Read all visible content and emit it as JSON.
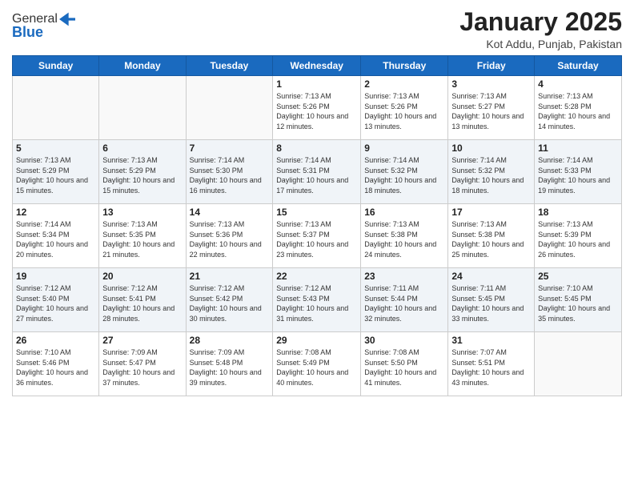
{
  "header": {
    "logo_line1": "General",
    "logo_line2": "Blue",
    "month_title": "January 2025",
    "location": "Kot Addu, Punjab, Pakistan"
  },
  "weekdays": [
    "Sunday",
    "Monday",
    "Tuesday",
    "Wednesday",
    "Thursday",
    "Friday",
    "Saturday"
  ],
  "weeks": [
    [
      {
        "day": "",
        "sunrise": "",
        "sunset": "",
        "daylight": ""
      },
      {
        "day": "",
        "sunrise": "",
        "sunset": "",
        "daylight": ""
      },
      {
        "day": "",
        "sunrise": "",
        "sunset": "",
        "daylight": ""
      },
      {
        "day": "1",
        "sunrise": "Sunrise: 7:13 AM",
        "sunset": "Sunset: 5:26 PM",
        "daylight": "Daylight: 10 hours and 12 minutes."
      },
      {
        "day": "2",
        "sunrise": "Sunrise: 7:13 AM",
        "sunset": "Sunset: 5:26 PM",
        "daylight": "Daylight: 10 hours and 13 minutes."
      },
      {
        "day": "3",
        "sunrise": "Sunrise: 7:13 AM",
        "sunset": "Sunset: 5:27 PM",
        "daylight": "Daylight: 10 hours and 13 minutes."
      },
      {
        "day": "4",
        "sunrise": "Sunrise: 7:13 AM",
        "sunset": "Sunset: 5:28 PM",
        "daylight": "Daylight: 10 hours and 14 minutes."
      }
    ],
    [
      {
        "day": "5",
        "sunrise": "Sunrise: 7:13 AM",
        "sunset": "Sunset: 5:29 PM",
        "daylight": "Daylight: 10 hours and 15 minutes."
      },
      {
        "day": "6",
        "sunrise": "Sunrise: 7:13 AM",
        "sunset": "Sunset: 5:29 PM",
        "daylight": "Daylight: 10 hours and 15 minutes."
      },
      {
        "day": "7",
        "sunrise": "Sunrise: 7:14 AM",
        "sunset": "Sunset: 5:30 PM",
        "daylight": "Daylight: 10 hours and 16 minutes."
      },
      {
        "day": "8",
        "sunrise": "Sunrise: 7:14 AM",
        "sunset": "Sunset: 5:31 PM",
        "daylight": "Daylight: 10 hours and 17 minutes."
      },
      {
        "day": "9",
        "sunrise": "Sunrise: 7:14 AM",
        "sunset": "Sunset: 5:32 PM",
        "daylight": "Daylight: 10 hours and 18 minutes."
      },
      {
        "day": "10",
        "sunrise": "Sunrise: 7:14 AM",
        "sunset": "Sunset: 5:32 PM",
        "daylight": "Daylight: 10 hours and 18 minutes."
      },
      {
        "day": "11",
        "sunrise": "Sunrise: 7:14 AM",
        "sunset": "Sunset: 5:33 PM",
        "daylight": "Daylight: 10 hours and 19 minutes."
      }
    ],
    [
      {
        "day": "12",
        "sunrise": "Sunrise: 7:14 AM",
        "sunset": "Sunset: 5:34 PM",
        "daylight": "Daylight: 10 hours and 20 minutes."
      },
      {
        "day": "13",
        "sunrise": "Sunrise: 7:13 AM",
        "sunset": "Sunset: 5:35 PM",
        "daylight": "Daylight: 10 hours and 21 minutes."
      },
      {
        "day": "14",
        "sunrise": "Sunrise: 7:13 AM",
        "sunset": "Sunset: 5:36 PM",
        "daylight": "Daylight: 10 hours and 22 minutes."
      },
      {
        "day": "15",
        "sunrise": "Sunrise: 7:13 AM",
        "sunset": "Sunset: 5:37 PM",
        "daylight": "Daylight: 10 hours and 23 minutes."
      },
      {
        "day": "16",
        "sunrise": "Sunrise: 7:13 AM",
        "sunset": "Sunset: 5:38 PM",
        "daylight": "Daylight: 10 hours and 24 minutes."
      },
      {
        "day": "17",
        "sunrise": "Sunrise: 7:13 AM",
        "sunset": "Sunset: 5:38 PM",
        "daylight": "Daylight: 10 hours and 25 minutes."
      },
      {
        "day": "18",
        "sunrise": "Sunrise: 7:13 AM",
        "sunset": "Sunset: 5:39 PM",
        "daylight": "Daylight: 10 hours and 26 minutes."
      }
    ],
    [
      {
        "day": "19",
        "sunrise": "Sunrise: 7:12 AM",
        "sunset": "Sunset: 5:40 PM",
        "daylight": "Daylight: 10 hours and 27 minutes."
      },
      {
        "day": "20",
        "sunrise": "Sunrise: 7:12 AM",
        "sunset": "Sunset: 5:41 PM",
        "daylight": "Daylight: 10 hours and 28 minutes."
      },
      {
        "day": "21",
        "sunrise": "Sunrise: 7:12 AM",
        "sunset": "Sunset: 5:42 PM",
        "daylight": "Daylight: 10 hours and 30 minutes."
      },
      {
        "day": "22",
        "sunrise": "Sunrise: 7:12 AM",
        "sunset": "Sunset: 5:43 PM",
        "daylight": "Daylight: 10 hours and 31 minutes."
      },
      {
        "day": "23",
        "sunrise": "Sunrise: 7:11 AM",
        "sunset": "Sunset: 5:44 PM",
        "daylight": "Daylight: 10 hours and 32 minutes."
      },
      {
        "day": "24",
        "sunrise": "Sunrise: 7:11 AM",
        "sunset": "Sunset: 5:45 PM",
        "daylight": "Daylight: 10 hours and 33 minutes."
      },
      {
        "day": "25",
        "sunrise": "Sunrise: 7:10 AM",
        "sunset": "Sunset: 5:45 PM",
        "daylight": "Daylight: 10 hours and 35 minutes."
      }
    ],
    [
      {
        "day": "26",
        "sunrise": "Sunrise: 7:10 AM",
        "sunset": "Sunset: 5:46 PM",
        "daylight": "Daylight: 10 hours and 36 minutes."
      },
      {
        "day": "27",
        "sunrise": "Sunrise: 7:09 AM",
        "sunset": "Sunset: 5:47 PM",
        "daylight": "Daylight: 10 hours and 37 minutes."
      },
      {
        "day": "28",
        "sunrise": "Sunrise: 7:09 AM",
        "sunset": "Sunset: 5:48 PM",
        "daylight": "Daylight: 10 hours and 39 minutes."
      },
      {
        "day": "29",
        "sunrise": "Sunrise: 7:08 AM",
        "sunset": "Sunset: 5:49 PM",
        "daylight": "Daylight: 10 hours and 40 minutes."
      },
      {
        "day": "30",
        "sunrise": "Sunrise: 7:08 AM",
        "sunset": "Sunset: 5:50 PM",
        "daylight": "Daylight: 10 hours and 41 minutes."
      },
      {
        "day": "31",
        "sunrise": "Sunrise: 7:07 AM",
        "sunset": "Sunset: 5:51 PM",
        "daylight": "Daylight: 10 hours and 43 minutes."
      },
      {
        "day": "",
        "sunrise": "",
        "sunset": "",
        "daylight": ""
      }
    ]
  ]
}
